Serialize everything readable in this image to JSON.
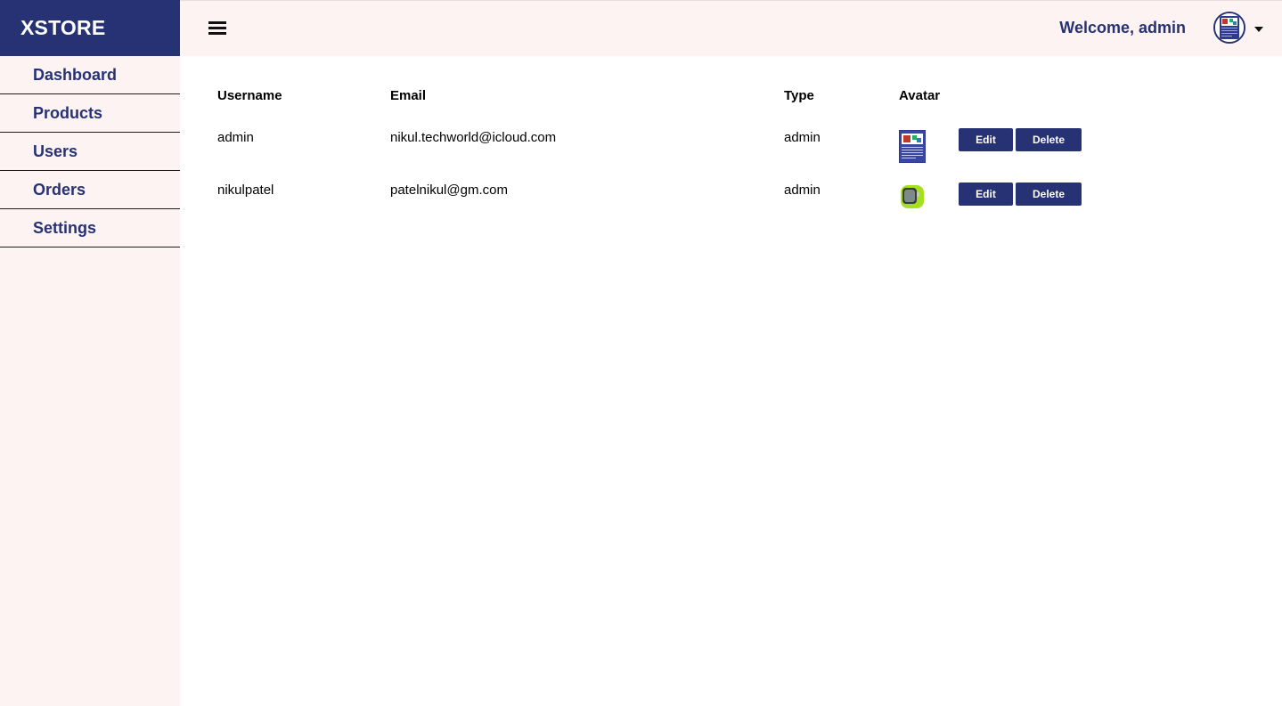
{
  "brand": {
    "title": "XSTORE",
    "color": "#263274"
  },
  "sidebar": {
    "items": [
      {
        "label": "Dashboard"
      },
      {
        "label": "Products"
      },
      {
        "label": "Users"
      },
      {
        "label": "Orders"
      },
      {
        "label": "Settings"
      }
    ]
  },
  "header": {
    "menu_icon": "hamburger-icon",
    "welcome": "Welcome, admin",
    "avatar_icon": "user-avatar-icon",
    "dropdown_icon": "caret-down-icon"
  },
  "table": {
    "headers": {
      "username": "Username",
      "email": "Email",
      "type": "Type",
      "avatar": "Avatar"
    },
    "rows": [
      {
        "username": "admin",
        "email": "nikul.techworld@icloud.com",
        "type": "admin",
        "avatar_icon": "poster-thumbnail-icon",
        "edit": "Edit",
        "delete": "Delete"
      },
      {
        "username": "nikulpatel",
        "email": "patelnikul@gm.com",
        "type": "admin",
        "avatar_icon": "smartwatch-thumbnail-icon",
        "edit": "Edit",
        "delete": "Delete"
      }
    ]
  }
}
